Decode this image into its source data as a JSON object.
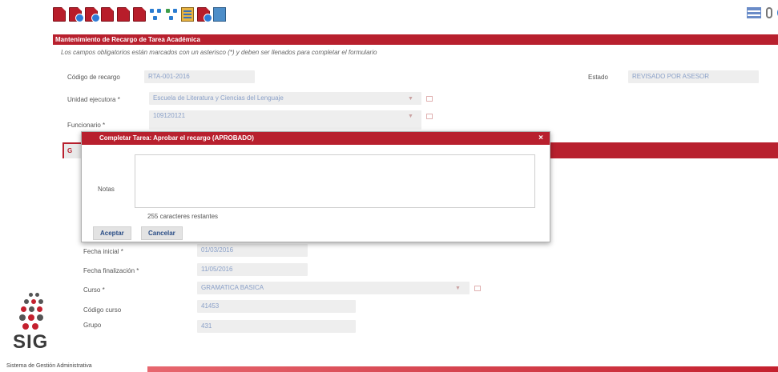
{
  "toolbar": {
    "icons": [
      "document-icon",
      "document-add-icon",
      "document-add-icon",
      "document-edit-icon",
      "document-edit-icon",
      "document-edit-icon",
      "network-icon",
      "network-icon",
      "spreadsheet-icon",
      "document-add-icon",
      "image-icon"
    ],
    "right_icons": [
      "list-icon",
      "attachment-icon",
      "help-icon"
    ],
    "help_label": "?"
  },
  "form": {
    "title": "Mantenimiento de Recargo de Tarea Académica",
    "info_text": "Los campos obligatorios están marcados con un asterisco (*) y deben ser llenados para completar el formulario",
    "codigo_label": "Código de recargo",
    "codigo_value": "RTA-001-2016",
    "estado_label": "Estado",
    "estado_value": "REVISADO POR ASESOR",
    "unidad_label": "Unidad ejecutora *",
    "unidad_value": "Escuela de Literatura y Ciencias del Lenguaje",
    "funcionario_label": "Funcionario *",
    "funcionario_value": "109120121",
    "tab_label": "G",
    "fecha_inicial_label": "Fecha inicial *",
    "fecha_inicial_value": "01/03/2016",
    "fecha_final_label": "Fecha finalización *",
    "fecha_final_value": "11/05/2016",
    "curso_label": "Curso *",
    "curso_value": "GRAMATICA BASICA",
    "codigo_curso_label": "Código curso",
    "codigo_curso_value": "41453",
    "grupo_label": "Grupo",
    "grupo_value": "431"
  },
  "modal": {
    "title": "Completar Tarea: Aprobar el recargo (APROBADO)",
    "close_label": "×",
    "notes_label": "Notas",
    "notes_value": "",
    "chars_text": "255 caracteres restantes",
    "accept_label": "Aceptar",
    "cancel_label": "Cancelar"
  },
  "logo": {
    "text": "SIG",
    "subtitle": "Sistema de Gestión Administrativa"
  },
  "colors": {
    "accent": "#b8202e",
    "link": "#2a4d86"
  }
}
